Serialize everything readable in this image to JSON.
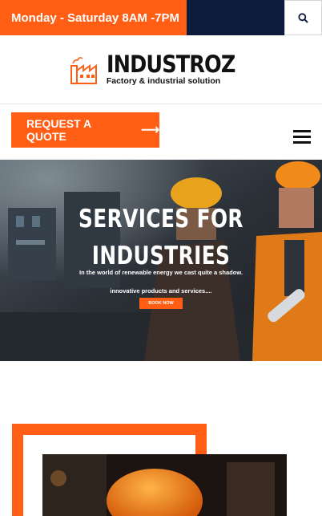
{
  "topbar": {
    "hours": "Monday - Saturday 8AM -7PM",
    "search_icon": "search-icon",
    "colors": {
      "orange": "#ff5e14",
      "navy": "#0d1b3d"
    }
  },
  "logo": {
    "name": "INDUSTROZ",
    "tagline": "Factory & industrial solution",
    "icon": "factory-icon"
  },
  "actions": {
    "quote_label": "REQUEST A QUOTE",
    "quote_arrow": "⟶",
    "menu_icon": "hamburger-menu-icon"
  },
  "hero": {
    "title_line1": "SERVICES FOR",
    "title_line2": "INDUSTRIES",
    "subtitle_line1": "In the world of renewable energy we cast quite a shadow.",
    "subtitle_line2": "innovative products and services....",
    "button_label": "BOOK NOW"
  }
}
